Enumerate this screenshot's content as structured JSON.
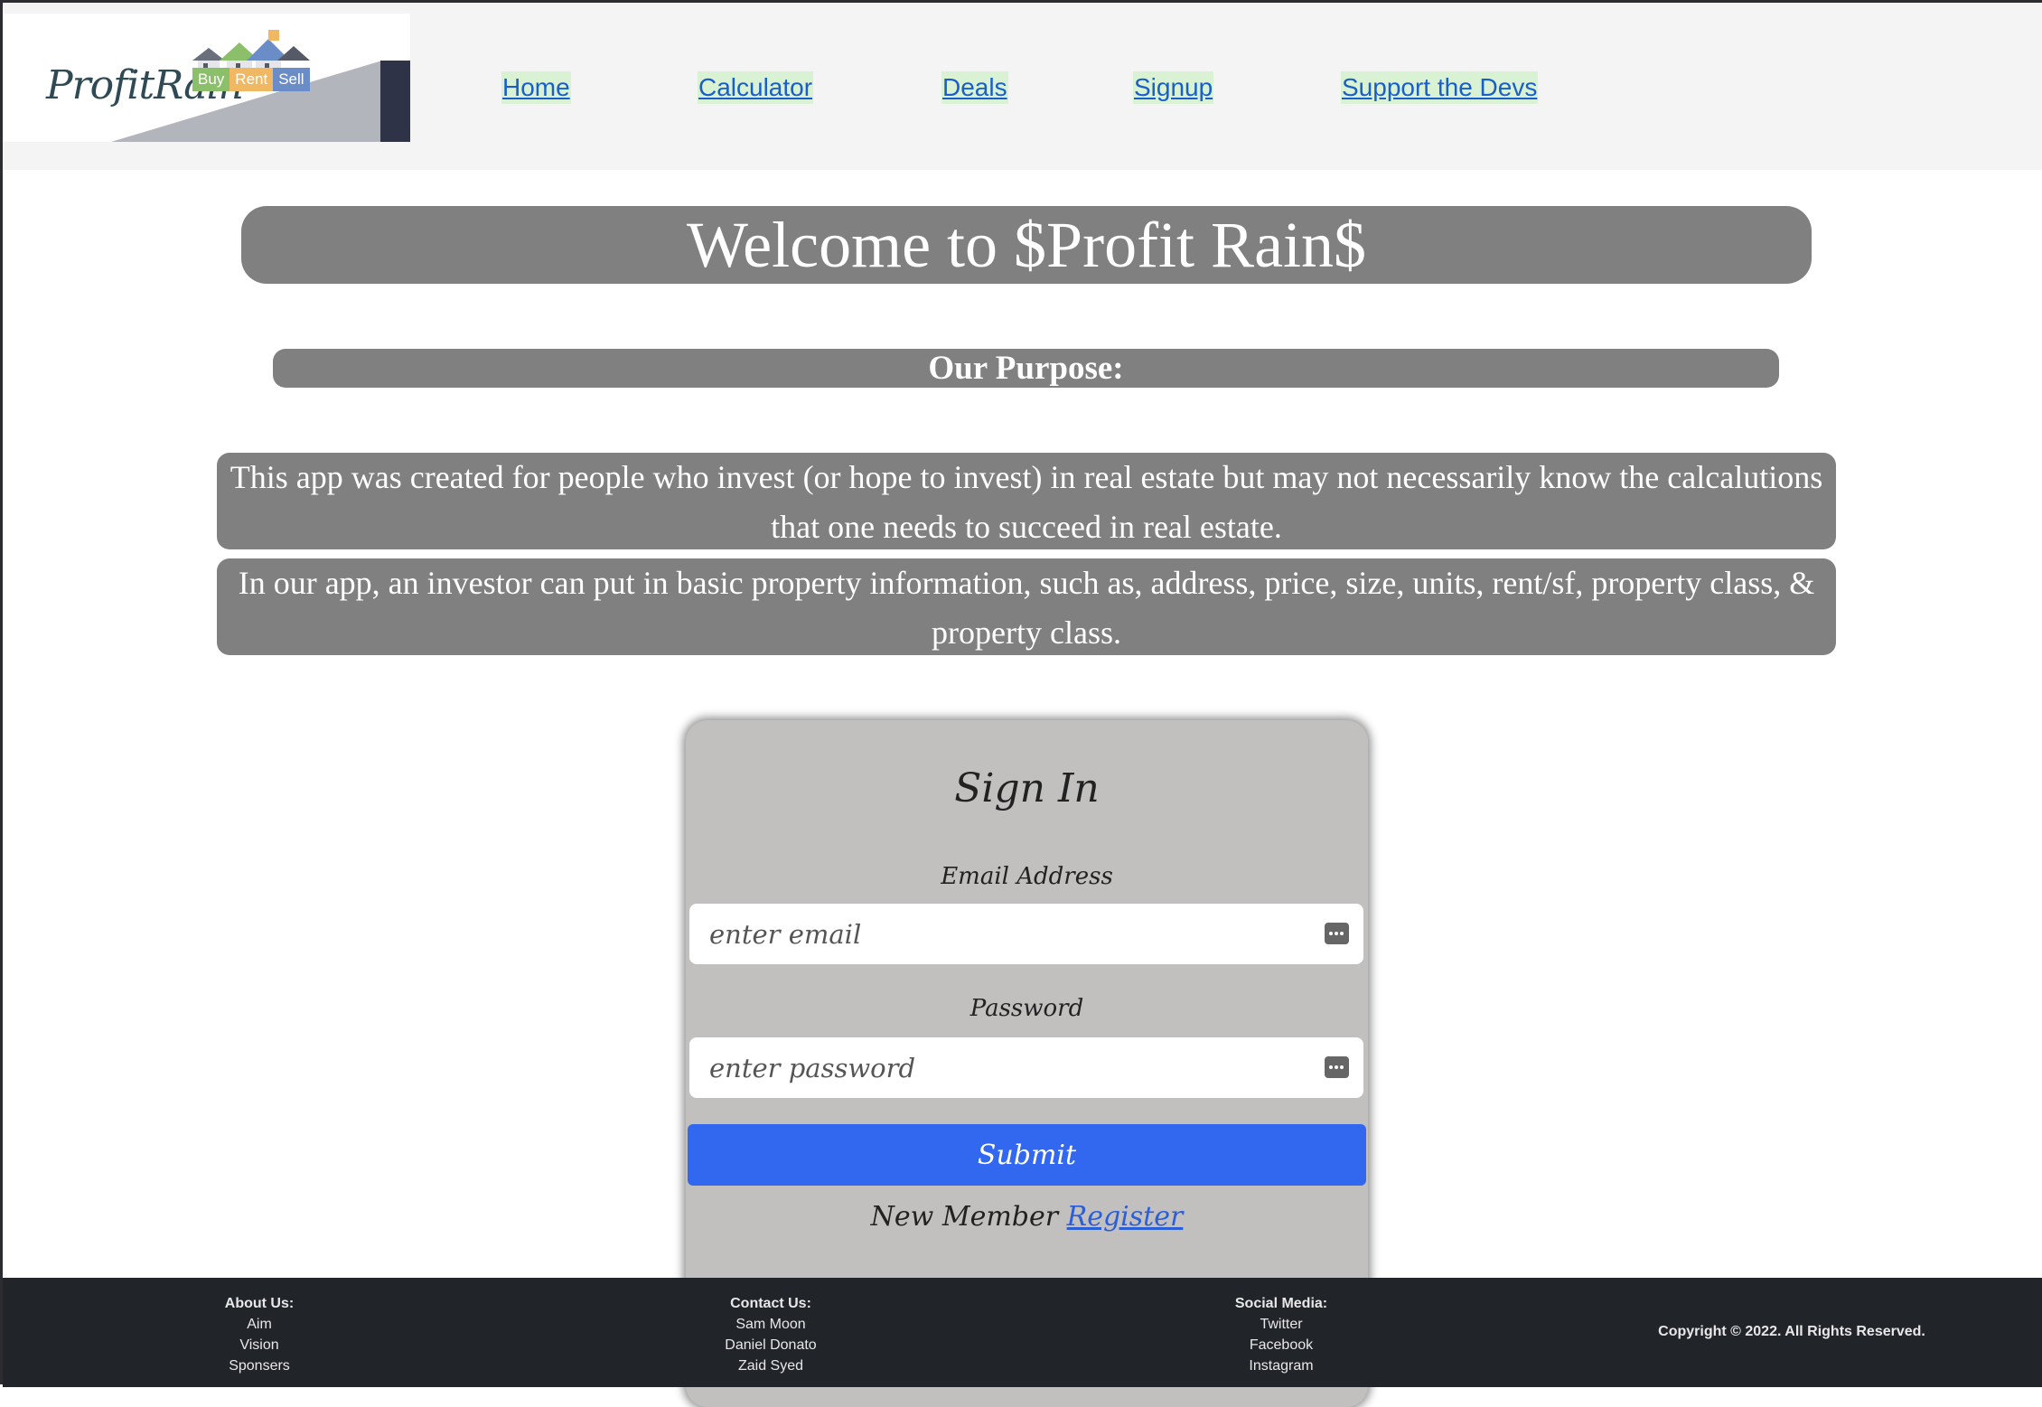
{
  "brand": {
    "logo_name": "ProfitRain",
    "logo_tags": [
      "Buy",
      "Rent",
      "Sell"
    ]
  },
  "nav": {
    "items": [
      "Home",
      "Calculator",
      "Deals",
      "Signup",
      "Support the Devs"
    ]
  },
  "hero": {
    "title": "Welcome to $Profit Rain$",
    "purpose_heading": "Our Purpose:",
    "paragraph1": "This app was created for people who invest (or hope to invest) in real estate but may not necessarily know the calcalutions that one needs to succeed in real estate.",
    "paragraph2": "In our app, an investor can put in basic property information, such as, address, price, size, units, rent/sf, property class, & property class."
  },
  "signin": {
    "title": "Sign In",
    "email_label": "Email Address",
    "email_placeholder": "enter email",
    "password_label": "Password",
    "password_placeholder": "enter password",
    "submit_label": "Submit",
    "new_member_text": "New Member",
    "register_link": "Register"
  },
  "footer": {
    "about": {
      "heading": "About Us:",
      "items": [
        "Aim",
        "Vision",
        "Sponsers"
      ]
    },
    "contact": {
      "heading": "Contact Us:",
      "items": [
        "Sam Moon",
        "Daniel Donato",
        "Zaid Syed"
      ]
    },
    "social": {
      "heading": "Social Media:",
      "items": [
        "Twitter",
        "Facebook",
        "Instagram"
      ]
    },
    "copyright": "Copyright © 2022. All Rights Reserved."
  },
  "colors": {
    "banner": "#808080",
    "card": "#c2bfbf",
    "submit": "#3268f0",
    "link": "#1a5fc9",
    "footer": "#212429"
  },
  "icons": [
    "house-logo-icon",
    "password-key-icon"
  ]
}
